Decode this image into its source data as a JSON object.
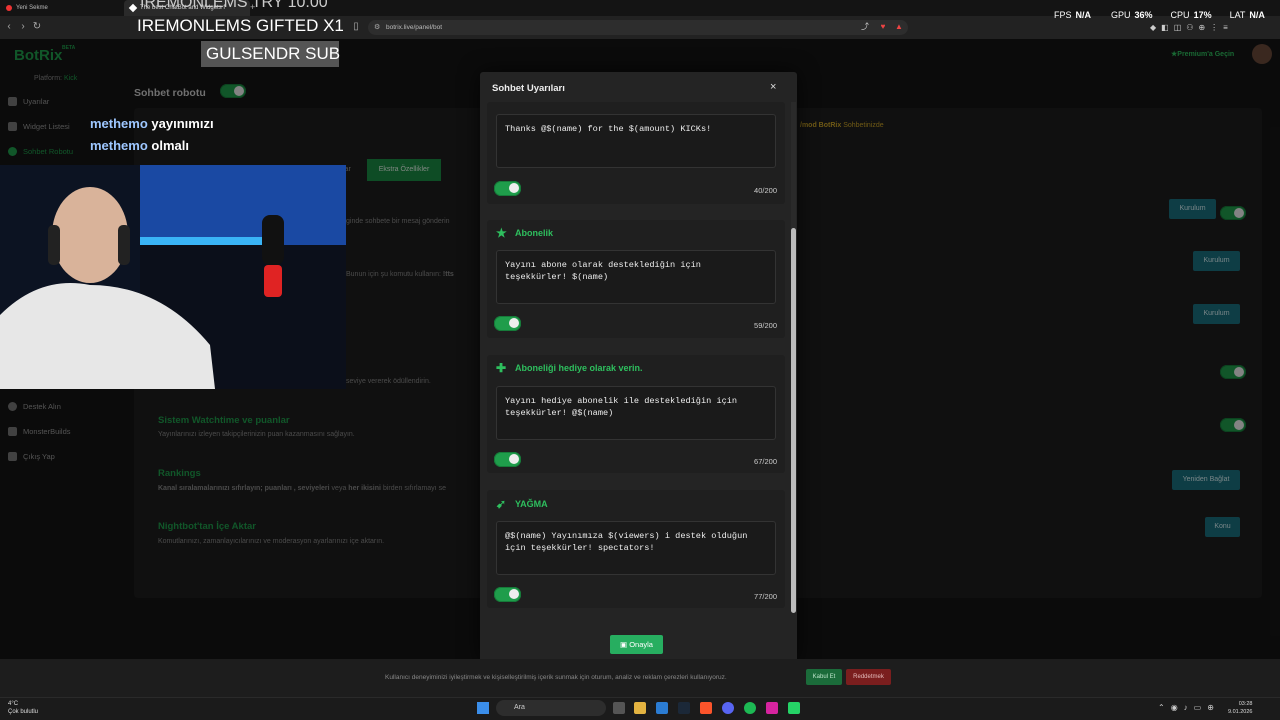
{
  "browser": {
    "tabs": [
      "Yeni Sekme",
      "The best ChatBot and Widgets f"
    ],
    "url": "botrix.live/panel/bot"
  },
  "stats": {
    "fps_label": "FPS",
    "fps": "N/A",
    "gpu_label": "GPU",
    "gpu": "36%",
    "cpu_label": "CPU",
    "cpu": "17%",
    "lat_label": "LAT",
    "lat": "N/A"
  },
  "stream_overlay": {
    "ticker_top": "IREMONLEMS  TRY 10.00",
    "ticker_main": "IREMONLEMS  GIFTED X1",
    "sub_badge": "GULSENDR  SUB",
    "chat": [
      {
        "user": "methemo",
        "msg": "yayınımızı"
      },
      {
        "user": "methemo",
        "msg": "olmalı"
      }
    ]
  },
  "sidebar": {
    "logo": "BotRix",
    "beta": "BETA",
    "platform_label": "Platform:",
    "platform_value": "Kick",
    "items": [
      "Uyarılar",
      "Widget Listesi",
      "Sohbet Robotu",
      "Destek Alın",
      "MonsterBuilds",
      "Çıkış Yap"
    ]
  },
  "header": {
    "premium": "Premium'a Geçin"
  },
  "main": {
    "bot_title": "Sohbet robotu",
    "mod_hint_cmd": "/mod BotRix",
    "mod_hint_rest": "Sohbetinizde",
    "tab_extra": "Ekstra Özellikler",
    "tab_prev": "lar",
    "line1": "ginde sohbete bir mesaj gönderin",
    "line2": "Bunun için şu komutu kullanın:",
    "line2_cmd": "!tts",
    "line3": "seviye vererek ödüllendirin.",
    "install": "Kurulum",
    "sections": [
      {
        "title": "Sistem Watchtime ve puanlar",
        "desc": "Yayınlarınızı izleyen takipçilerinizin puan kazanmasını sağlayın."
      },
      {
        "title": "Rankings",
        "desc_bold": "Kanal sıralamalarınızı sıfırlayın; puanları , seviyeleri",
        "desc_mid": "veya",
        "desc_bold2": "her ikisini",
        "desc_end": "birden sıfırlamayı se"
      },
      {
        "title": "Nightbot'tan İçe Aktar",
        "desc": "Komutlarınızı, zamanlayıcılarınızı ve moderasyon ayarlarınızı içe aktarın."
      }
    ],
    "reconnect": "Yeniden Bağlat",
    "connect": "Konu"
  },
  "modal": {
    "title": "Sohbet Uyarıları",
    "close": "×",
    "cards": [
      {
        "title": "",
        "text": "Thanks @$(name) for the $(amount) KICKs!",
        "count": "40/200"
      },
      {
        "title": "Abonelik",
        "icon": "star-icon",
        "text": "Yayını abone olarak desteklediğin için\nteşekkürler! $(name)",
        "count": "59/200"
      },
      {
        "title": "Aboneliği hediye olarak verin.",
        "icon": "gift-icon",
        "text": "Yayını hediye abonelik ile desteklediğin için\nteşekkürler! @$(name)",
        "count": "67/200"
      },
      {
        "title": "YAĞMA",
        "icon": "raid-icon",
        "text": "@$(name) Yayınımıza $(viewers) i destek olduğun\niçin teşekkürler! spectators!",
        "count": "77/200"
      }
    ],
    "approve": "Onayla"
  },
  "cookie": {
    "text": "Kullanıcı deneyiminizi iyileştirmek ve kişiselleştirilmiş içerik sunmak için oturum, analiz ve reklam çerezleri kullanıyoruz.",
    "accept": "Kabul Et",
    "reject": "Reddetmek"
  },
  "taskbar": {
    "weather_temp": "4°C",
    "weather_desc": "Çok bulutlu",
    "search": "Ara",
    "time": "03:28",
    "date": "9.01.2026"
  },
  "colors": {
    "accent": "#1f9d4b",
    "teal_button": "#1a6f7f",
    "bg": "#151515",
    "modal_bg": "#242424"
  }
}
